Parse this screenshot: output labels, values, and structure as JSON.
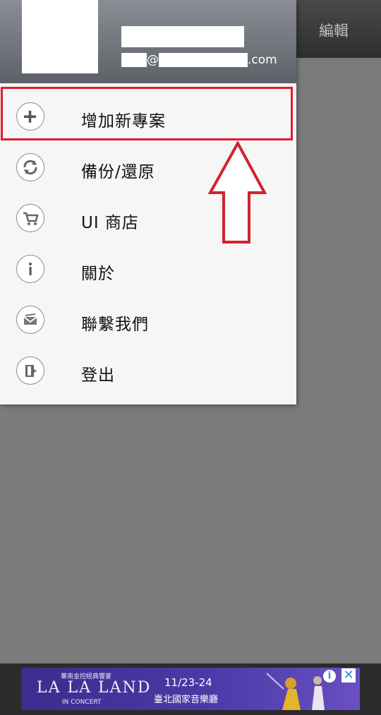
{
  "appbar": {
    "edit_label": "編輯"
  },
  "drawer": {
    "user": {
      "email_at": "@",
      "email_domain": ".com"
    },
    "menu": [
      {
        "label": "增加新專案",
        "icon": "plus-icon"
      },
      {
        "label": "備份/還原",
        "icon": "sync-icon"
      },
      {
        "label": "UI 商店",
        "icon": "cart-icon"
      },
      {
        "label": "關於",
        "icon": "info-icon"
      },
      {
        "label": "聯繫我們",
        "icon": "mail-icon"
      },
      {
        "label": "登出",
        "icon": "logout-icon"
      }
    ]
  },
  "ad": {
    "top_text": "華南金控經典饗宴",
    "title": "LA LA LAND",
    "subtitle": "IN CONCERT",
    "date": "11/23-24",
    "venue": "臺北國家音樂廳",
    "info_glyph": "i",
    "close_glyph": "✕"
  },
  "colors": {
    "highlight": "#e21b2a"
  }
}
